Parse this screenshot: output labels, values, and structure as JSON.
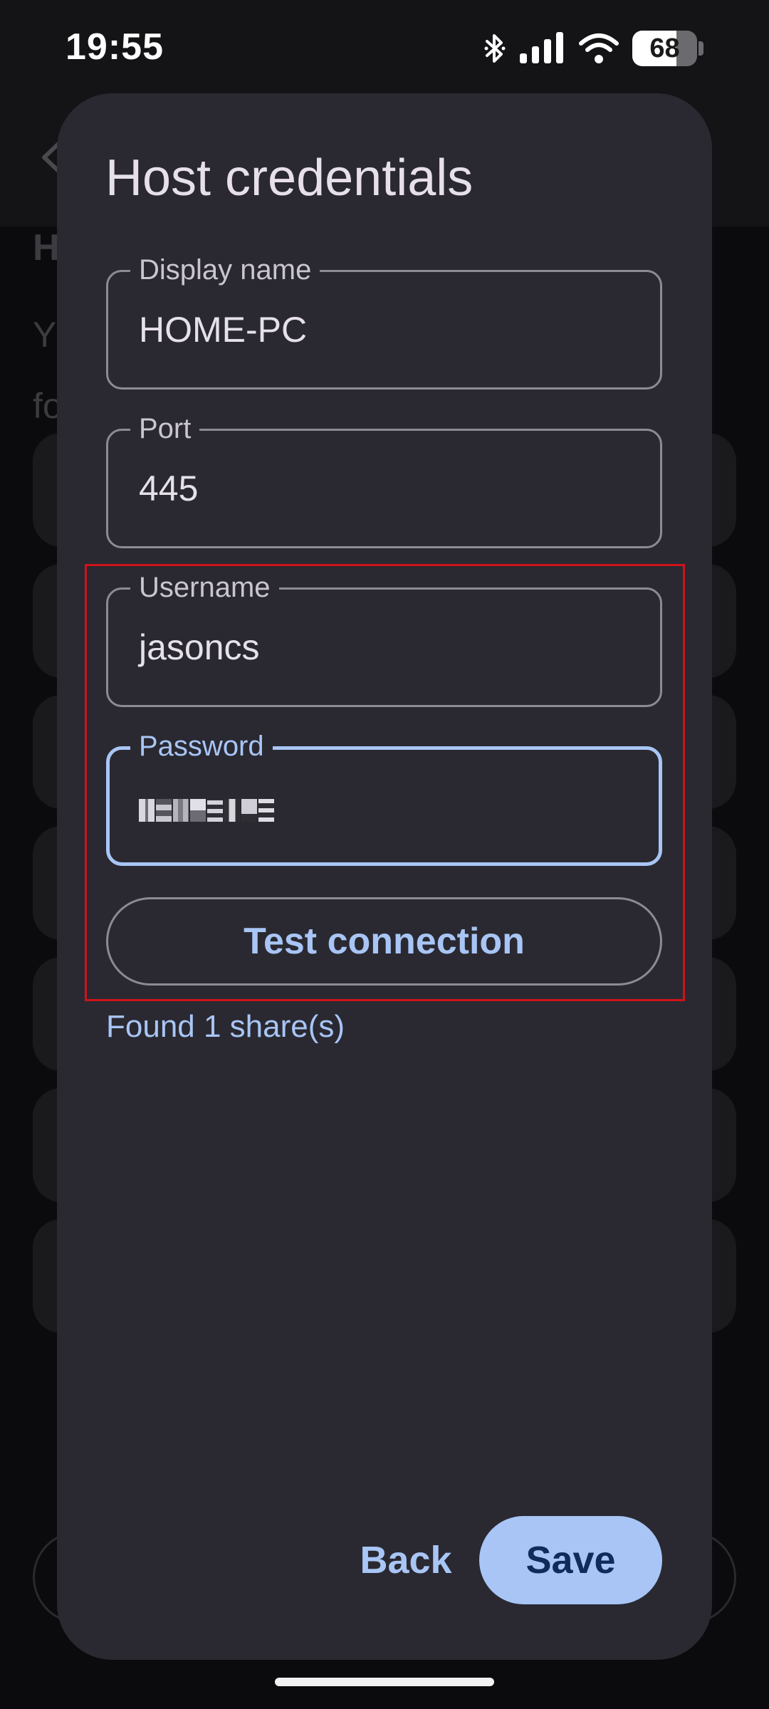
{
  "status_bar": {
    "time": "19:55",
    "battery_level": "68",
    "battery_fraction": 0.68,
    "icons": [
      "bluetooth-icon",
      "signal-icon",
      "wifi-icon",
      "battery-icon"
    ]
  },
  "background": {
    "heading_fragment": "H",
    "description_fragment": "Y\nfo"
  },
  "dialog": {
    "title": "Host credentials",
    "fields": {
      "display_name": {
        "label": "Display name",
        "value": "HOME-PC"
      },
      "port": {
        "label": "Port",
        "value": "445"
      },
      "username": {
        "label": "Username",
        "value": "jasoncs"
      },
      "password": {
        "label": "Password",
        "masked": true,
        "focused": true
      }
    },
    "test_connection_label": "Test connection",
    "result_message": "Found 1 share(s)",
    "back_label": "Back",
    "save_label": "Save"
  },
  "colors": {
    "accent": "#a8c5f5",
    "dialog_surface": "#2a2931",
    "highlight": "#d0121b",
    "on_accent": "#0f2c5a"
  }
}
